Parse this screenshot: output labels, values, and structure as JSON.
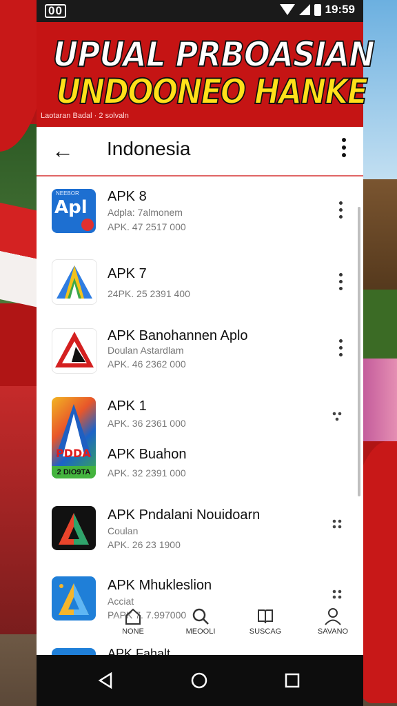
{
  "status": {
    "left": "00",
    "time": "19:59"
  },
  "banner": {
    "line1": "UPUAL PRBOASIAN",
    "line2": "UNDOONEO HANKE",
    "subtitle": "Laotaran Badal · 2 solvaln"
  },
  "appbar": {
    "title": "Indonesia"
  },
  "apps": [
    {
      "name": "APK 8",
      "sub": "Adpla: 7almonem",
      "meta": "APK. 47 2517 000"
    },
    {
      "name": "APK 7",
      "sub": "",
      "meta": "24PK. 25 2391 400"
    },
    {
      "name": "APK Banohannen Aplo",
      "sub": "Doulan Astardlam",
      "meta": "APK. 46 2362 000"
    },
    {
      "name": "APK 1",
      "sub": "",
      "meta": "APK. 36 2361 000",
      "name2": "APK Buahon",
      "meta2": "APK. 32 2391 000",
      "icon_label": "2 DIO9TA",
      "icon_text": "PDDA"
    },
    {
      "name": "APK Pndalani Nouidoarn",
      "sub": "Coulan",
      "meta": "APK. 26 23 1900"
    },
    {
      "name": "APK Mhukleslion",
      "sub": "Acciat",
      "meta": "PAPK 7. 7.997000"
    },
    {
      "name": "APK Fahalt",
      "sub": "",
      "meta": ""
    }
  ],
  "icon1": {
    "text": "Apl",
    "small": "NEEBOR"
  },
  "bottom_nav": [
    {
      "label": "NONE",
      "icon": "home-icon"
    },
    {
      "label": "MEOOLI",
      "icon": "search-icon"
    },
    {
      "label": "SUSCAG",
      "icon": "book-icon"
    },
    {
      "label": "SAVANO",
      "icon": "person-icon"
    }
  ],
  "colors": {
    "brand_red": "#c51414",
    "banner_yellow": "#ffe01a",
    "accent_blue": "#1d6fd1"
  }
}
